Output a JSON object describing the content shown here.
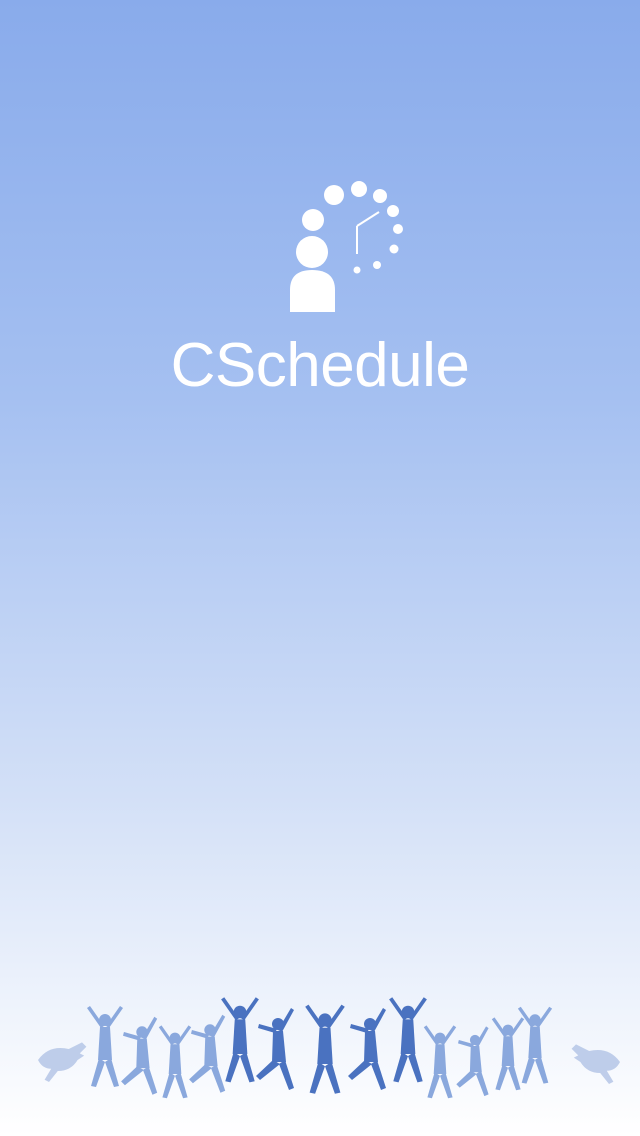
{
  "app": {
    "name": "CSchedule"
  },
  "icons": {
    "logo": "person-with-clock-dots-icon",
    "footer_art": "jumping-people-silhouettes"
  },
  "colors": {
    "background_top": "#89abeb",
    "background_bottom": "#ffffff",
    "logo_and_text": "#ffffff",
    "silhouette": "#4a72c0"
  }
}
